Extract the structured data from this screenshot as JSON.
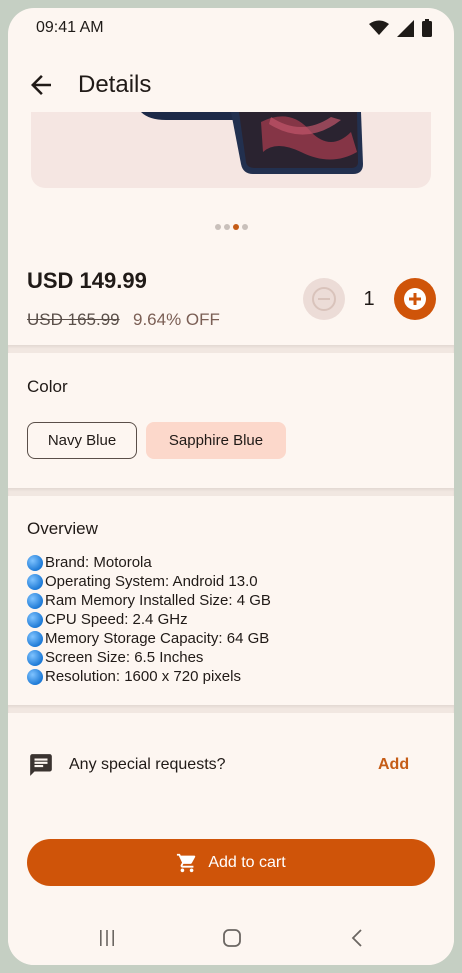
{
  "status": {
    "time": "09:41 AM",
    "icons": [
      "wifi-icon",
      "signal-icon",
      "battery-icon"
    ]
  },
  "appbar": {
    "title": "Details",
    "back_icon": "arrow-left-icon"
  },
  "carousel": {
    "page_count": 4,
    "active_index": 2
  },
  "pricing": {
    "price": "USD 149.99",
    "old_price": "USD 165.99",
    "discount": "9.64% OFF"
  },
  "quantity": {
    "value": "1",
    "minus_icon": "minus-circle-icon",
    "plus_icon": "plus-circle-icon"
  },
  "color_section": {
    "title": "Color",
    "options": [
      {
        "label": "Navy Blue",
        "selected": false
      },
      {
        "label": "Sapphire Blue",
        "selected": true
      }
    ]
  },
  "overview": {
    "title": "Overview",
    "items": [
      "Brand: Motorola",
      "Operating System: Android 13.0",
      "Ram Memory Installed Size: 4 GB",
      "CPU Speed: 2.4 GHz",
      "Memory Storage Capacity: 64 GB",
      "Screen Size: 6.5 Inches",
      "Resolution: 1600 x 720 pixels"
    ]
  },
  "special_request": {
    "label": "Any special requests?",
    "action": "Add",
    "icon": "message-icon"
  },
  "cart": {
    "label": "Add to cart",
    "icon": "cart-icon"
  },
  "colors": {
    "accent": "#cf5409",
    "background": "#fdf6f1",
    "selected_chip": "#fcd8cb"
  }
}
